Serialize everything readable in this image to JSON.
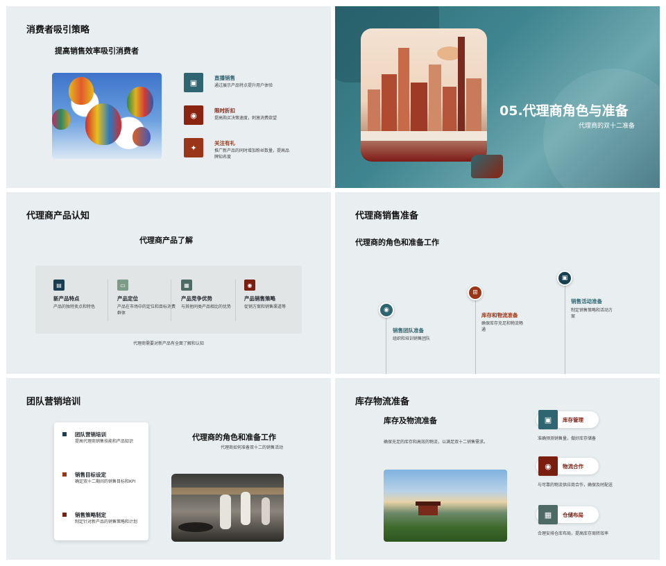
{
  "slide1": {
    "title": "消费者吸引策略",
    "subtitle": "提高销售效率吸引消费者",
    "items": [
      {
        "label": "直播销售",
        "desc": "通过展示产品特点提升用户体验",
        "icon": "image-icon"
      },
      {
        "label": "限时折扣",
        "desc": "提高购买决策速度，刺激消费欲望",
        "icon": "target-icon"
      },
      {
        "label": "关注有礼",
        "desc": "推广新产品的同时增加粉丝数量，提高品牌知名度",
        "icon": "gift-icon"
      }
    ]
  },
  "slide2": {
    "title": "05.代理商角色与准备",
    "subtitle": "代理商的双十二准备"
  },
  "slide3": {
    "title": "代理商产品认知",
    "subtitle": "代理商产品了解",
    "columns": [
      {
        "label": "新产品特点",
        "desc": "产品的独特卖点和特色"
      },
      {
        "label": "产品定位",
        "desc": "产品在市场中的定位和目标消费群体"
      },
      {
        "label": "产品竞争优势",
        "desc": "与其他同类产品相比的优势"
      },
      {
        "label": "产品销售策略",
        "desc": "促销方案和销售渠道等"
      }
    ],
    "footer": "代理商需要对新产品有全面了解和认知"
  },
  "slide4": {
    "title": "代理商销售准备",
    "subtitle": "代理商的角色和准备工作",
    "steps": [
      {
        "label": "销售团队准备",
        "desc": "组织和培训销售团队"
      },
      {
        "label": "库存和物流准备",
        "desc": "确保库存充足和物流畅通"
      },
      {
        "label": "销售活动准备",
        "desc": "制定销售策略和活动方案"
      }
    ]
  },
  "slide5": {
    "title": "团队营销培训",
    "heading": "代理商的角色和准备工作",
    "heading_desc": "代理商如何准备双十二的销售活动",
    "items": [
      {
        "label": "团队营销培训",
        "desc": "提高代理商销售技能和产品知识"
      },
      {
        "label": "销售目标设定",
        "desc": "确定双十二期间的销售目标和KPI"
      },
      {
        "label": "销售策略制定",
        "desc": "制定针对新产品的销售策略和计划"
      }
    ]
  },
  "slide6": {
    "title": "库存物流准备",
    "subtitle": "库存及物流准备",
    "desc": "确保充足的库存和高效的物流，以满足双十二销售需求。",
    "items": [
      {
        "label": "库存管理",
        "desc": "准确预测销售量，做好库存储备"
      },
      {
        "label": "物流合作",
        "desc": "与可靠的物流供应商合作，确保及时配送"
      },
      {
        "label": "仓储布局",
        "desc": "合理安排仓库布局，提高库存周转效率"
      }
    ]
  },
  "colors": {
    "teal": "#2e6570",
    "red": "#8a2410",
    "bg": "#e9eef0"
  }
}
